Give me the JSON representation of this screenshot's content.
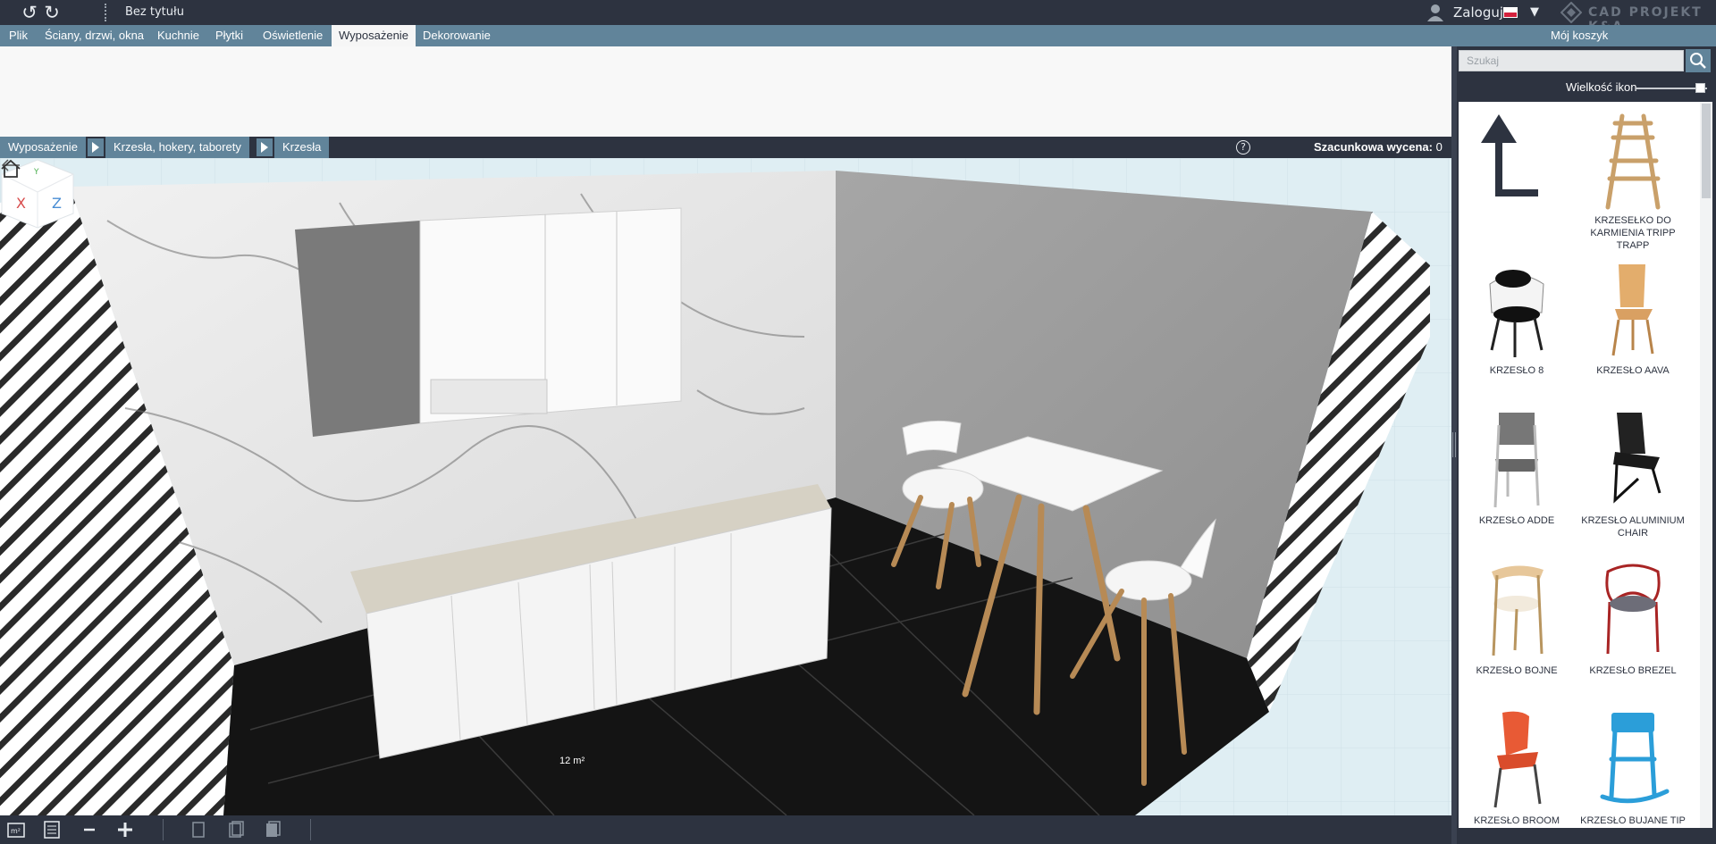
{
  "topbar": {
    "doc_title": "Bez tytułu",
    "login_label": "Zaloguj",
    "logo_text": "CAD PROJEKT K&A"
  },
  "menu": {
    "tabs": [
      {
        "label": "Plik"
      },
      {
        "label": "Ściany, drzwi, okna"
      },
      {
        "label": "Kuchnie"
      },
      {
        "label": "Płytki"
      },
      {
        "label": "Oświetlenie"
      },
      {
        "label": "Wyposażenie",
        "active": true
      },
      {
        "label": "Dekorowanie"
      }
    ],
    "cart_label": "Mój koszyk"
  },
  "breadcrumb": {
    "items": [
      "Wyposażenie",
      "Krzesła, hokery, taborety",
      "Krzesła"
    ],
    "estimate_label": "Szacunkowa wycena:",
    "estimate_value": "0 zł"
  },
  "viewport": {
    "floor_area": "12 m²",
    "viewcube": {
      "x": "X",
      "y": "Y",
      "z": "Z"
    }
  },
  "panel": {
    "search_placeholder": "Szukaj",
    "icon_size_label": "Wielkość ikon",
    "icon_size_level": 0.9,
    "items": [
      {
        "label": "",
        "icon": "up-arrow-icon"
      },
      {
        "label": "KRZESEŁKO DO KARMIENIA TRIPP TRAPP",
        "icon": "high-chair-icon"
      },
      {
        "label": "KRZESŁO 8",
        "icon": "chair-8-icon"
      },
      {
        "label": "KRZESŁO AAVA",
        "icon": "chair-aava-icon"
      },
      {
        "label": "KRZESŁO ADDE",
        "icon": "chair-adde-icon"
      },
      {
        "label": "KRZESŁO ALUMINIUM CHAIR",
        "icon": "chair-aluminium-icon"
      },
      {
        "label": "KRZESŁO BOJNE",
        "icon": "chair-bojne-icon"
      },
      {
        "label": "KRZESŁO BREZEL",
        "icon": "chair-brezel-icon"
      },
      {
        "label": "KRZESŁO BROOM CHAIR",
        "icon": "chair-broom-icon"
      },
      {
        "label": "KRZESŁO BUJANE TIP",
        "icon": "chair-bujane-icon"
      }
    ]
  },
  "colors": {
    "dark_bar": "#2d3340",
    "accent": "#61849a",
    "ribbon": "#f8f8f8",
    "viewport_bg": "#dfeef3"
  }
}
